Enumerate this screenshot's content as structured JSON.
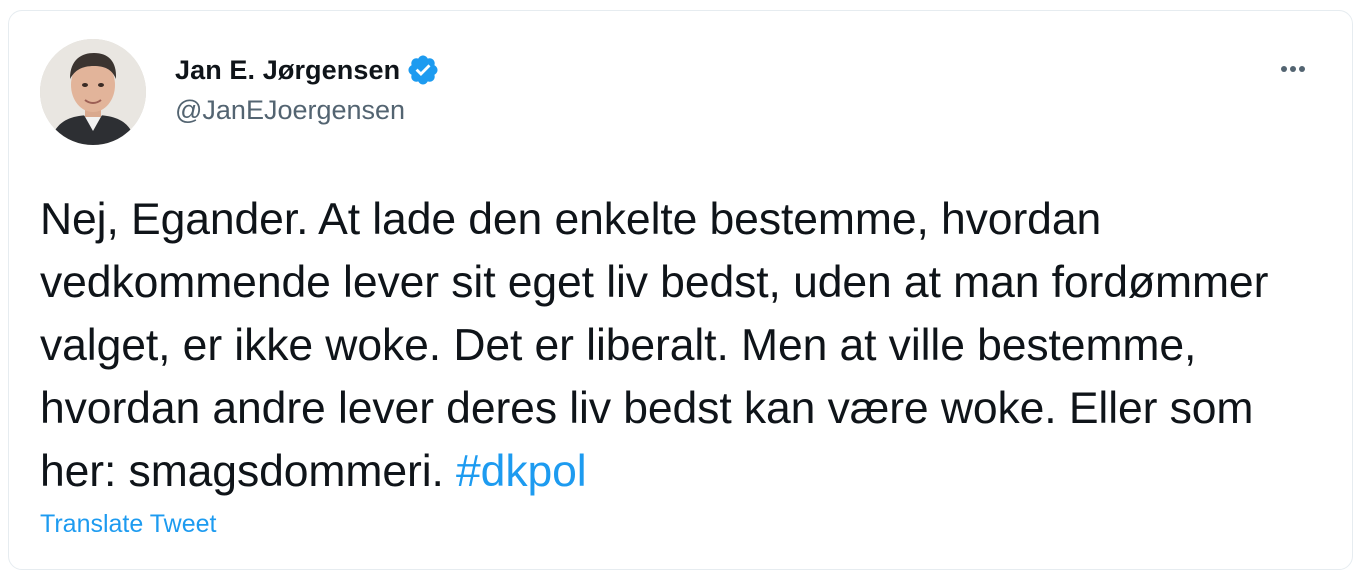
{
  "author": {
    "display_name": "Jan E. Jørgensen",
    "handle": "@JanEJoergensen",
    "verified": true
  },
  "tweet": {
    "text": "Nej, Egander. At lade den enkelte bestemme, hvordan vedkommende lever sit eget liv bedst, uden at man fordømmer valget, er ikke woke. Det er liberalt. Men at ville bestemme, hvordan andre lever deres liv bedst kan være woke. Eller som her: smagsdommeri. ",
    "hashtag": "#dkpol"
  },
  "actions": {
    "translate_label": "Translate Tweet"
  },
  "icons": {
    "verified": "verified-badge-icon",
    "more": "more-options-icon"
  },
  "colors": {
    "accent": "#1d9bf0",
    "text": "#0f1419",
    "secondary_text": "#536471",
    "border": "#e6ecf0"
  }
}
